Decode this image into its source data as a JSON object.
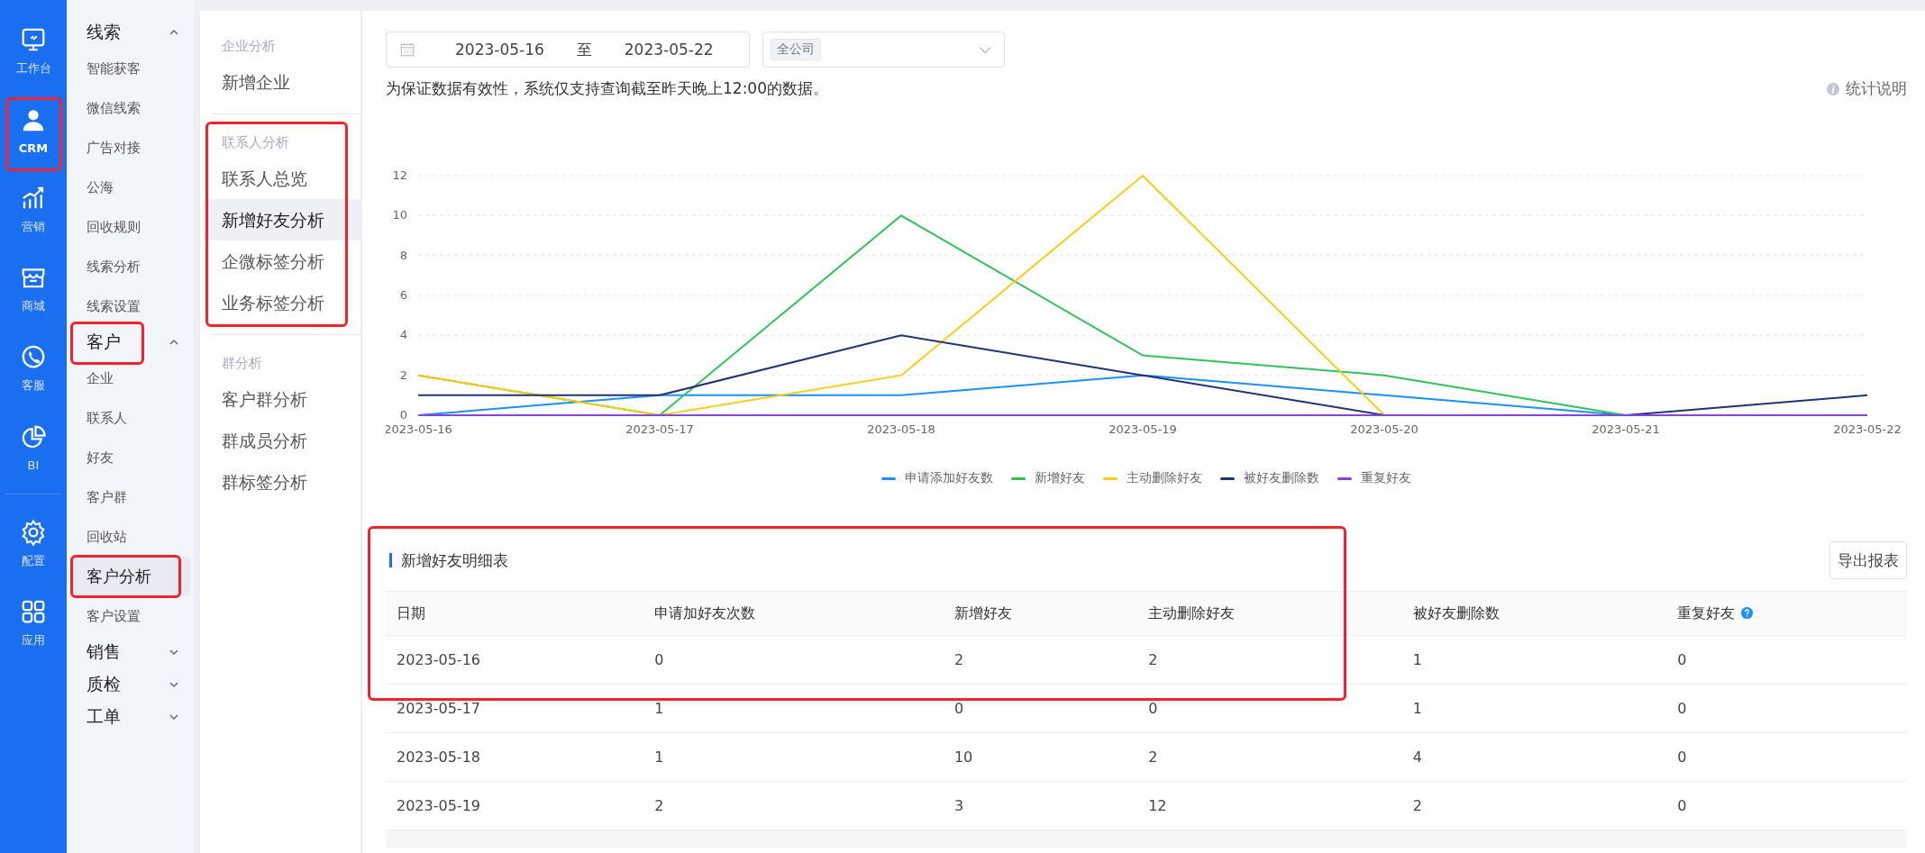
{
  "rail": {
    "items": [
      {
        "label": "工作台",
        "selected": false,
        "annotated": false
      },
      {
        "label": "CRM",
        "selected": true,
        "annotated": true
      },
      {
        "label": "营销",
        "selected": false,
        "annotated": false
      },
      {
        "label": "商城",
        "selected": false,
        "annotated": false
      },
      {
        "label": "客服",
        "selected": false,
        "annotated": false
      },
      {
        "label": "BI",
        "selected": false,
        "annotated": false
      },
      {
        "label": "配置",
        "selected": false,
        "annotated": false
      },
      {
        "label": "应用",
        "selected": false,
        "annotated": false
      }
    ]
  },
  "sidebar": {
    "groups": [
      {
        "label": "线索",
        "expanded": true,
        "annotated": false,
        "items": [
          {
            "label": "智能获客",
            "selected": false,
            "annotated": false
          },
          {
            "label": "微信线索",
            "selected": false,
            "annotated": false
          },
          {
            "label": "广告对接",
            "selected": false,
            "annotated": false
          },
          {
            "label": "公海",
            "selected": false,
            "annotated": false
          },
          {
            "label": "回收规则",
            "selected": false,
            "annotated": false
          },
          {
            "label": "线索分析",
            "selected": false,
            "annotated": false
          },
          {
            "label": "线索设置",
            "selected": false,
            "annotated": false
          }
        ]
      },
      {
        "label": "客户",
        "expanded": true,
        "annotated": true,
        "items": [
          {
            "label": "企业",
            "selected": false,
            "annotated": false
          },
          {
            "label": "联系人",
            "selected": false,
            "annotated": false
          },
          {
            "label": "好友",
            "selected": false,
            "annotated": false
          },
          {
            "label": "客户群",
            "selected": false,
            "annotated": false
          },
          {
            "label": "回收站",
            "selected": false,
            "annotated": false
          },
          {
            "label": "客户分析",
            "selected": true,
            "annotated": true
          },
          {
            "label": "客户设置",
            "selected": false,
            "annotated": false
          }
        ]
      },
      {
        "label": "销售",
        "expanded": false,
        "annotated": false
      },
      {
        "label": "质检",
        "expanded": false,
        "annotated": false
      },
      {
        "label": "工单",
        "expanded": false,
        "annotated": false
      }
    ]
  },
  "submenu": {
    "sections": [
      {
        "title": "企业分析",
        "annotated": false,
        "items": [
          {
            "label": "新增企业",
            "selected": false
          }
        ]
      },
      {
        "title": "联系人分析",
        "annotated": true,
        "items": [
          {
            "label": "联系人总览",
            "selected": false
          },
          {
            "label": "新增好友分析",
            "selected": true
          },
          {
            "label": "企微标签分析",
            "selected": false
          },
          {
            "label": "业务标签分析",
            "selected": false
          }
        ]
      },
      {
        "title": "群分析",
        "annotated": false,
        "items": [
          {
            "label": "客户群分析",
            "selected": false
          },
          {
            "label": "群成员分析",
            "selected": false
          },
          {
            "label": "群标签分析",
            "selected": false
          }
        ]
      }
    ]
  },
  "filters": {
    "date_start": "2023-05-16",
    "date_separator": "至",
    "date_end": "2023-05-22",
    "scope_tag": "全公司"
  },
  "notice": "为保证数据有效性，系统仅支持查询截至昨天晚上12:00的数据。",
  "stats_help": "统计说明",
  "chart": {
    "chart_data": {
      "type": "line",
      "grid": true,
      "legend": "bottom",
      "categories": [
        "2023-05-16",
        "2023-05-17",
        "2023-05-18",
        "2023-05-19",
        "2023-05-20",
        "2023-05-21",
        "2023-05-22"
      ],
      "ylim": [
        0,
        12
      ],
      "yticks": [
        0,
        2,
        4,
        6,
        8,
        10,
        12
      ],
      "series": [
        {
          "name": "申请添加好友数",
          "color": "#1890ff",
          "values": [
            0,
            1,
            1,
            2,
            1,
            0,
            null
          ]
        },
        {
          "name": "新增好友",
          "color": "#2fc25b",
          "values": [
            2,
            0,
            10,
            3,
            2,
            0,
            null
          ]
        },
        {
          "name": "主动删除好友",
          "color": "#facc14",
          "values": [
            2,
            0,
            2,
            12,
            0,
            0,
            null
          ]
        },
        {
          "name": "被好友删除数",
          "color": "#223273",
          "values": [
            1,
            1,
            4,
            2,
            0,
            0,
            1
          ]
        },
        {
          "name": "重复好友",
          "color": "#8543e0",
          "values": [
            0,
            0,
            0,
            0,
            0,
            0,
            0
          ]
        }
      ]
    }
  },
  "detail": {
    "title": "新增好友明细表",
    "annotated": true,
    "export_button": "导出报表",
    "columns": [
      {
        "label": "日期",
        "help": false
      },
      {
        "label": "申请加好友次数",
        "help": false
      },
      {
        "label": "新增好友",
        "help": false
      },
      {
        "label": "主动删除好友",
        "help": false
      },
      {
        "label": "被好友删除数",
        "help": false
      },
      {
        "label": "重复好友",
        "help": true
      }
    ],
    "rows": [
      [
        "2023-05-16",
        "0",
        "2",
        "2",
        "1",
        "0"
      ],
      [
        "2023-05-17",
        "1",
        "0",
        "0",
        "1",
        "0"
      ],
      [
        "2023-05-18",
        "1",
        "10",
        "2",
        "4",
        "0"
      ],
      [
        "2023-05-19",
        "2",
        "3",
        "12",
        "2",
        "0"
      ]
    ]
  }
}
